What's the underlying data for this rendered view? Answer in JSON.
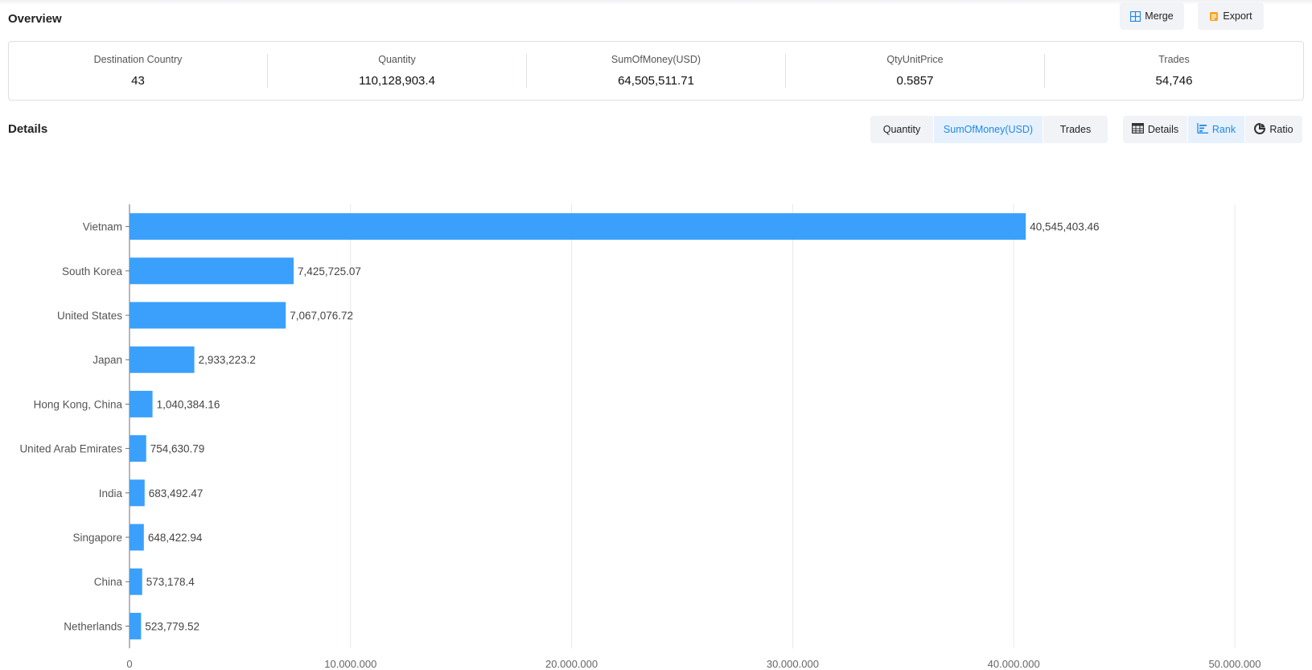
{
  "overview": {
    "title": "Overview",
    "merge_label": "Merge",
    "export_label": "Export",
    "stats": [
      {
        "label": "Destination Country",
        "value": "43"
      },
      {
        "label": "Quantity",
        "value": "110,128,903.4"
      },
      {
        "label": "SumOfMoney(USD)",
        "value": "64,505,511.71"
      },
      {
        "label": "QtyUnitPrice",
        "value": "0.5857"
      },
      {
        "label": "Trades",
        "value": "54,746"
      }
    ]
  },
  "details": {
    "title": "Details",
    "metric_tabs": [
      {
        "label": "Quantity",
        "active": false
      },
      {
        "label": "SumOfMoney(USD)",
        "active": true
      },
      {
        "label": "Trades",
        "active": false
      }
    ],
    "view_tabs": [
      {
        "label": "Details",
        "icon": "table-icon",
        "active": false
      },
      {
        "label": "Rank",
        "icon": "bar-rank-icon",
        "active": true
      },
      {
        "label": "Ratio",
        "icon": "pie-chart-icon",
        "active": false
      }
    ]
  },
  "colors": {
    "bar": "#3aa0fb",
    "accent": "#1e88e5",
    "merge_icon": "#1e88e5",
    "export_icon": "#f5a623"
  },
  "chart_data": {
    "type": "bar",
    "orientation": "horizontal",
    "categories": [
      "Vietnam",
      "South Korea",
      "United States",
      "Japan",
      "Hong Kong, China",
      "United Arab Emirates",
      "India",
      "Singapore",
      "China",
      "Netherlands"
    ],
    "values": [
      40545403.46,
      7425725.07,
      7067076.72,
      2933223.2,
      1040384.16,
      754630.79,
      683492.47,
      648422.94,
      573178.4,
      523779.52
    ],
    "value_labels": [
      "40,545,403.46",
      "7,425,725.07",
      "7,067,076.72",
      "2,933,223.2",
      "1,040,384.16",
      "754,630.79",
      "683,492.47",
      "648,422.94",
      "573,178.4",
      "523,779.52"
    ],
    "xlim": [
      0,
      50000000
    ],
    "x_ticks": [
      0,
      10000000,
      20000000,
      30000000,
      40000000,
      50000000
    ],
    "x_tick_labels": [
      "0",
      "10,000,000",
      "20,000,000",
      "30,000,000",
      "40,000,000",
      "50,000,000"
    ],
    "grid": true,
    "legend": false
  }
}
